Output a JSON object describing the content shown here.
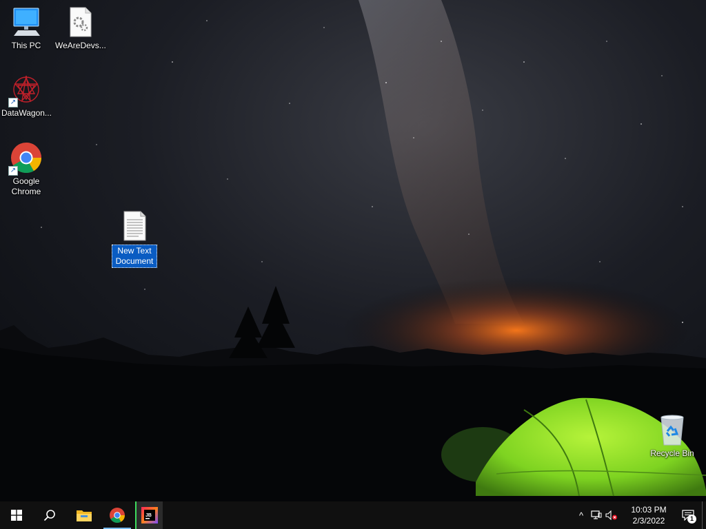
{
  "desktop": {
    "icons": [
      {
        "label": "This PC",
        "icon": "computer-icon"
      },
      {
        "label": "WeAreDevs...",
        "icon": "settings-file-icon"
      },
      {
        "label": "DataWagon...",
        "icon": "datawagon-icon"
      },
      {
        "label": "Google Chrome",
        "icon": "chrome-icon"
      },
      {
        "label": "New Text Document",
        "icon": "text-document-icon",
        "selected": true
      },
      {
        "label": "Recycle Bin",
        "icon": "recycle-bin-icon"
      }
    ]
  },
  "taskbar": {
    "start": "windows-start-icon",
    "search": "search-icon",
    "apps": [
      "file-explorer-icon",
      "chrome-icon",
      "jetbrains-toolbox-icon"
    ],
    "tray": {
      "overflow": "^",
      "network": "network-icon",
      "volume": "volume-muted-icon",
      "time": "10:03 PM",
      "date": "2/3/2022",
      "notification_count": "1"
    }
  },
  "colors": {
    "taskbar_bg": "#101010",
    "selection": "#0a5cc2",
    "active_indicator": "#76b9ed",
    "tent_green": "#7ed321"
  }
}
